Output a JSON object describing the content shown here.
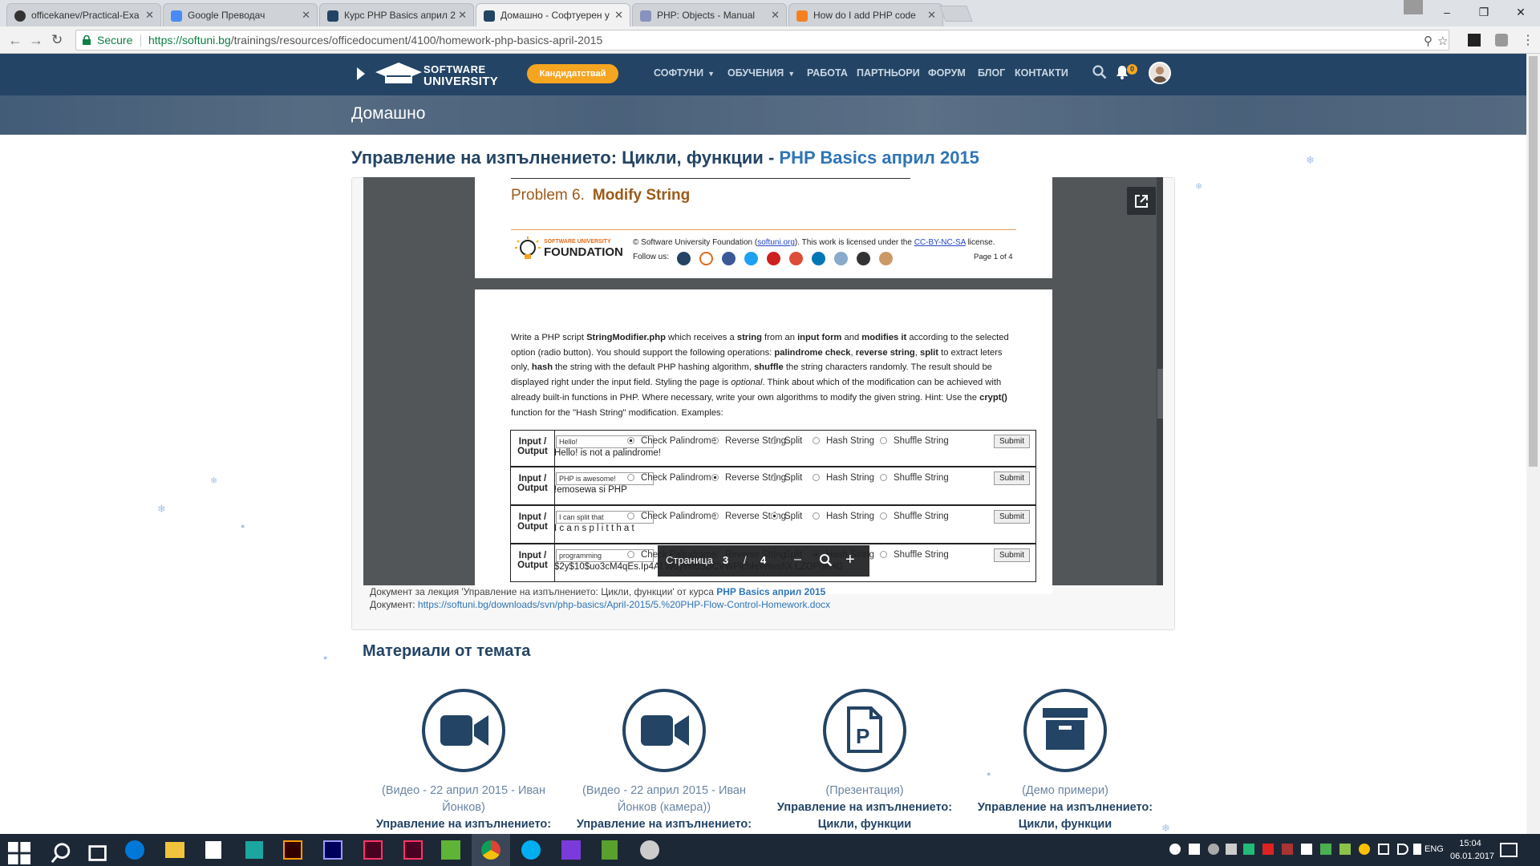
{
  "browser": {
    "tabs": [
      {
        "title": "officekanev/Practical-Exa",
        "icon": "github-icon"
      },
      {
        "title": "Google Преводач",
        "icon": "google-translate-icon"
      },
      {
        "title": "Курс PHP Basics април 2",
        "icon": "softuni-icon"
      },
      {
        "title": "Домашно - Софтуерен у",
        "icon": "softuni-icon"
      },
      {
        "title": "PHP: Objects - Manual",
        "icon": "php-icon"
      },
      {
        "title": "How do I add PHP code",
        "icon": "stackoverflow-icon"
      }
    ],
    "secure_label": "Secure",
    "url_host": "https://softuni.bg",
    "url_path": "/trainings/resources/officedocument/4100/homework-php-basics-april-2015"
  },
  "site": {
    "logo_line1": "SOFTWARE",
    "logo_line2": "UNIVERSITY",
    "apply_label": "Кандидатствай",
    "menu": [
      "СОФТУНИ",
      "ОБУЧЕНИЯ",
      "РАБОТА",
      "ПАРТНЬОРИ",
      "ФОРУМ",
      "БЛОГ",
      "КОНТАКТИ"
    ],
    "notification_count": "0",
    "banner_title": "Домашно"
  },
  "page": {
    "title_prefix": "Управление на изпълнението: Цикли, функции - ",
    "title_course": "PHP Basics април 2015"
  },
  "document": {
    "problem_no": "Problem 6.",
    "problem_title": "Modify String",
    "foundation_small": "SOFTWARE UNIVERSITY",
    "foundation_big": "FOUNDATION",
    "copyright_pre": "© Software University Foundation (",
    "copyright_link1": "softuni.org",
    "copyright_mid": "). This work is licensed under the ",
    "copyright_link2": "CC-BY-NC-SA",
    "copyright_post": " license.",
    "follow_label": "Follow us:",
    "page_label": "Page 1 of 4",
    "paragraph_html": "Write a PHP script <b>StringModifier.php</b> which receives a <b>string</b> from an <b>input form</b> and <b>modifies it</b> according to the selected option (radio button). You should support the following operations: <b>palindrome check</b>, <b>reverse string</b>, <b>split</b> to extract leters only, <b>hash</b> the string with the default PHP hashing algorithm, <b>shuffle</b> the string characters randomly. The result should be displayed right under the input field. Styling the page is <i>optional</i>. Think about which of the modification can be achieved with already built-in functions in PHP. Where necessary, write your own algorithms to modify the given string. Hint: Use the <b>crypt()</b> function for the \"Hash String\" modification. Examples:",
    "row_label_1": "Input /",
    "row_label_2": "Output",
    "options": [
      "Check Palindrome",
      "Reverse String",
      "Split",
      "Hash String",
      "Shuffle String"
    ],
    "submit_label": "Submit",
    "examples": [
      {
        "input": "Hello!",
        "selected": 0,
        "output": "Hello! is not a palindrome!"
      },
      {
        "input": "PHP is awesome!",
        "selected": 1,
        "output": "!emosewa si PHP"
      },
      {
        "input": "I can split that",
        "selected": 2,
        "output": "I c a n s p l i t t h a t"
      },
      {
        "input": "programming",
        "selected": 3,
        "output": "$2y$10$uo3cM4qEs.Ip4Af.WuyWf6SBCVWPlcbIeWIwsfiX.LZOPneHG"
      }
    ],
    "toolbar_page_label": "Страница",
    "toolbar_current_page": "3",
    "toolbar_sep": "/",
    "toolbar_total_pages": "4"
  },
  "caption": {
    "line1_pre": "Документ за лекция 'Управление на изпълнението: Цикли, функции' от курса ",
    "line1_link": "PHP Basics април 2015",
    "line2_pre": "Документ: ",
    "line2_link": "https://softuni.bg/downloads/svn/php-basics/April-2015/5.%20PHP-Flow-Control-Homework.docx"
  },
  "materials": {
    "heading": "Материали от темата",
    "items": [
      {
        "icon": "video-camera-icon",
        "label": "(Видео - 22 април 2015 - Иван Йонков)",
        "title": "Управление на изпълнението:"
      },
      {
        "icon": "video-camera-icon",
        "label": "(Видео - 22 април 2015 - Иван Йонков (камера))",
        "title": "Управление на изпълнението:"
      },
      {
        "icon": "presentation-icon",
        "label": "(Презентация)",
        "title": "Управление на изпълнението: Цикли, функции"
      },
      {
        "icon": "archive-box-icon",
        "label": "(Демо примери)",
        "title": "Управление на изпълнението: Цикли, функции"
      }
    ]
  },
  "taskbar": {
    "lang": "ENG",
    "time": "15:04",
    "date": "06.01.2017"
  },
  "colors": {
    "nav_bg": "#234465",
    "accent_orange": "#f6a521",
    "link_blue": "#2f75b5",
    "taskbar_bg": "#1d2836"
  }
}
